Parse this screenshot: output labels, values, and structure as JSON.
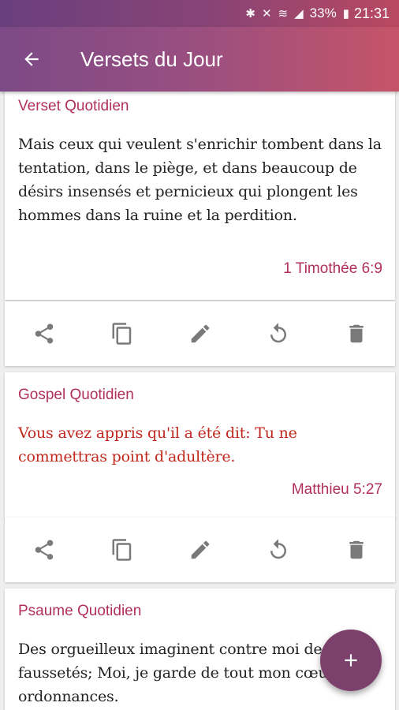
{
  "status_bar": {
    "battery": "33%",
    "time": "21:31"
  },
  "app_bar": {
    "title": "Versets du Jour"
  },
  "cards": [
    {
      "heading": "Verset Quotidien",
      "text": "Mais ceux qui veulent s'enrichir tombent dans la tentation, dans le piège, et dans beaucoup de désirs insensés et pernicieux qui plongent les hommes dans la ruine et la perdition.",
      "reference": "1 Timothée 6:9",
      "text_color": "#222222"
    },
    {
      "heading": "Gospel Quotidien",
      "text": "Vous avez appris qu'il a été dit: Tu ne commettras point d'adultère.",
      "reference": "Matthieu 5:27",
      "text_color": "#c0281e"
    },
    {
      "heading": "Psaume Quotidien",
      "text": "Des orgueilleux imaginent contre moi des faussetés; Moi, je garde de tout mon cœur tes ordonnances.",
      "text_color": "#222222"
    }
  ],
  "actions": [
    "share-icon",
    "copy-icon",
    "edit-icon",
    "refresh-icon",
    "delete-icon"
  ],
  "colors": {
    "accent": "#b0305a",
    "fab": "#7b416c",
    "icon": "#7a7a7a"
  }
}
